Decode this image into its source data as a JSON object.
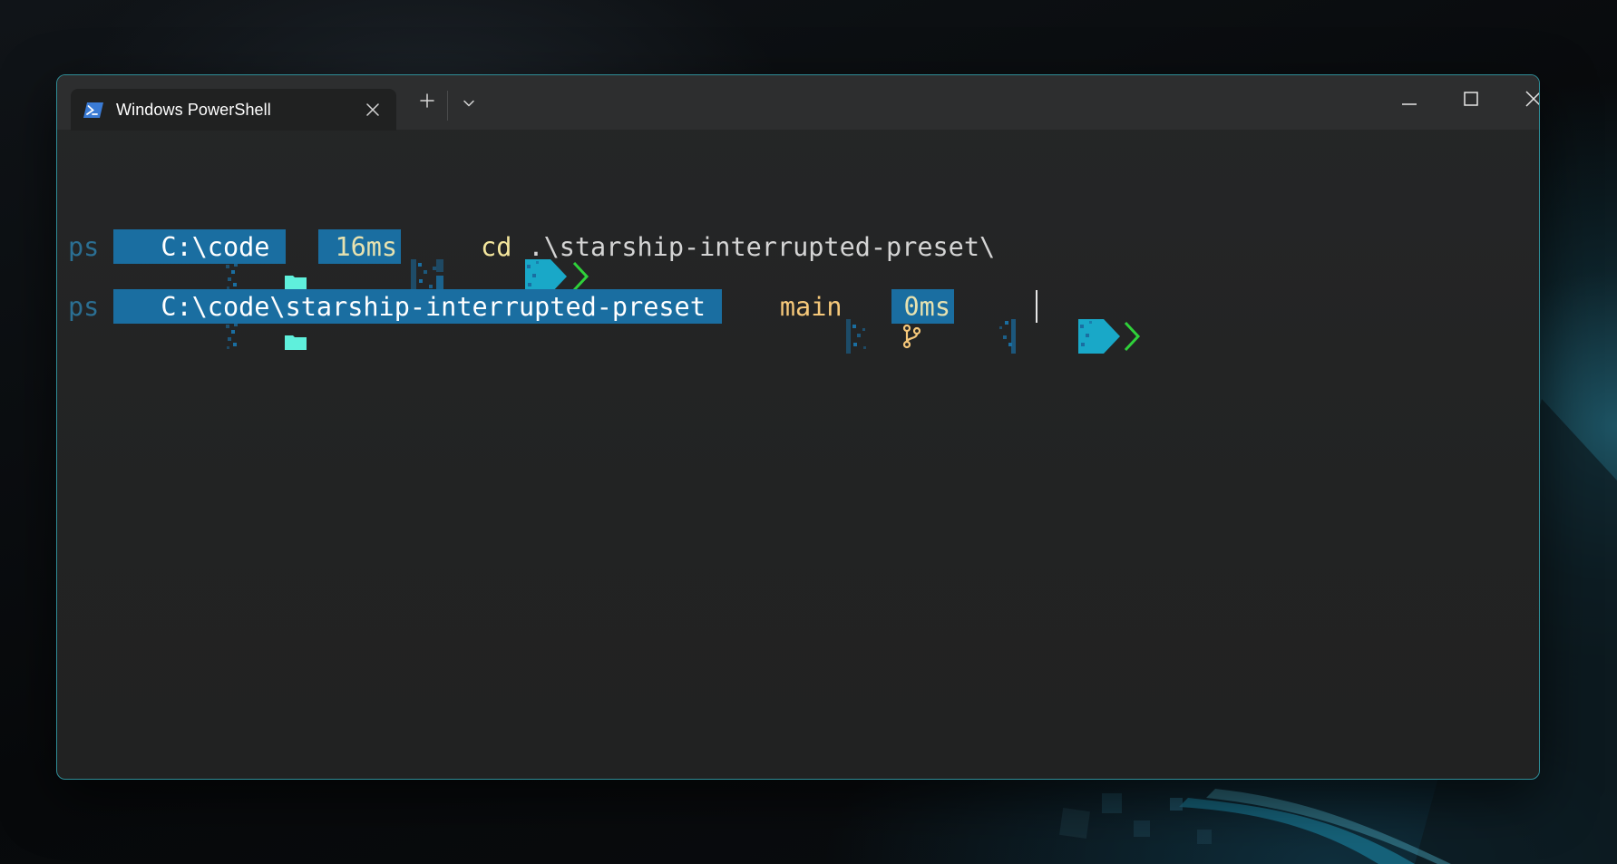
{
  "window": {
    "tab_title": "Windows PowerShell",
    "new_tab_symbol": "+",
    "accent_color": "#2f8d97"
  },
  "icons": {
    "tab": "powershell-icon",
    "tab_close": "close-icon",
    "new_tab": "plus-icon",
    "dropdown": "chevron-down-icon",
    "minimize": "minimize-icon",
    "maximize": "maximize-icon",
    "close": "close-icon",
    "directory": "folder-icon",
    "branch": "git-branch-icon"
  },
  "terminal": {
    "lines": [
      {
        "shell": "ps",
        "directory": "C:\\code",
        "duration": "16ms",
        "command_verb": "cd",
        "command_arg": ".\\starship-interrupted-preset\\"
      },
      {
        "shell": "ps",
        "directory": "C:\\code\\starship-interrupted-preset",
        "git_branch": "main",
        "duration": "0ms"
      }
    ],
    "colors": {
      "segment": "#1a6ea1",
      "arrow": "#19a8c8",
      "chevron": "#2fd13a",
      "duration_text": "#e7e2b0",
      "branch_text": "#f6c87a",
      "command_verb": "#f4e69d"
    }
  }
}
